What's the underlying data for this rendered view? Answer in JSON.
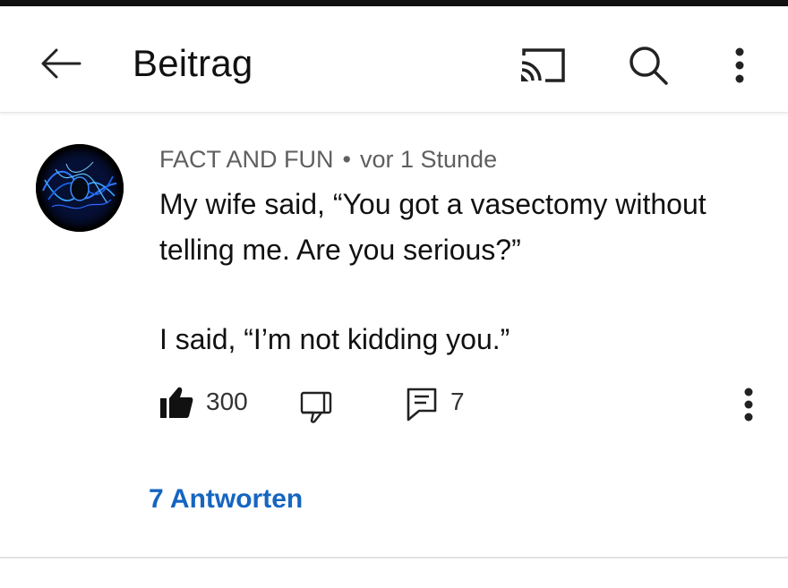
{
  "header": {
    "back_icon": "arrow-left-icon",
    "title": "Beitrag",
    "cast_icon": "cast-icon",
    "search_icon": "search-icon",
    "overflow_icon": "more-vert-icon"
  },
  "comment": {
    "author": "FACT AND FUN",
    "separator": "•",
    "time": "vor 1 Stunde",
    "text_line_1": "My wife said, “You got a vasectomy without telling me. Are you serious?”",
    "text_line_2": "I said, “I’m not kidding you.”",
    "like_count": "300",
    "reply_count": "7",
    "replies_link": "7 Antworten",
    "icons": {
      "like": "thumbs-up-filled-icon",
      "dislike": "thumbs-down-outline-icon",
      "reply": "comment-icon",
      "more": "more-vert-icon"
    }
  },
  "colors": {
    "link": "#1565c0",
    "meta_text": "#5f5f5f",
    "body_text": "#111111"
  }
}
